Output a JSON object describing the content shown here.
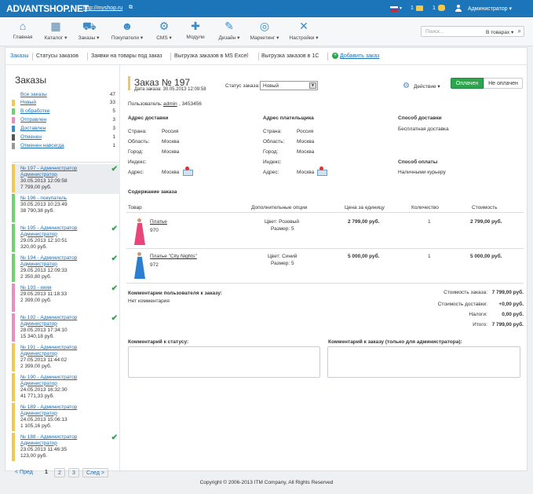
{
  "topbar": {
    "logo": "ADVANTSHOP.NET",
    "site_link": "http://myshop.ru",
    "ext_icon": "external-link-icon",
    "mail_count": "1",
    "messages_count": "1",
    "admin_name": "Администратор ▾",
    "bar_color": "#1c74b9"
  },
  "menu": [
    {
      "label": "Главная",
      "icon": "home-icon",
      "glyph": "⌂"
    },
    {
      "label": "Каталог ▾",
      "icon": "catalog-icon",
      "glyph": "▦"
    },
    {
      "label": "Заказы ▾",
      "icon": "cart-icon",
      "glyph": "⛟"
    },
    {
      "label": "Покупатели ▾",
      "icon": "users-icon",
      "glyph": "☻"
    },
    {
      "label": "CMS ▾",
      "icon": "gear-icon",
      "glyph": "⚙"
    },
    {
      "label": "Модули",
      "icon": "modules-icon",
      "glyph": "✚"
    },
    {
      "label": "Дизайн ▾",
      "icon": "palette-icon",
      "glyph": "✎"
    },
    {
      "label": "Маркетинг ▾",
      "icon": "target-icon",
      "glyph": "◎"
    },
    {
      "label": "Настройки ▾",
      "icon": "wrench-icon",
      "glyph": "✕"
    }
  ],
  "search": {
    "placeholder": "Поиск...",
    "scope": "В товарах ▾"
  },
  "tabs": [
    "Заказы",
    "Статусы заказов",
    "Заявки на товары под заказ",
    "Выгрузка заказов в MS Excel",
    "Выгрузка заказов в 1С",
    "Добавить заказ"
  ],
  "sidebar": {
    "title": "Заказы",
    "statuses": [
      {
        "name": "Все заказы",
        "count": "47",
        "color": "#ffffff"
      },
      {
        "name": "Новый",
        "count": "33",
        "color": "#f2c94c"
      },
      {
        "name": "В обработке",
        "count": "5",
        "color": "#6fd26f"
      },
      {
        "name": "Отправлен",
        "count": "3",
        "color": "#e88fc0"
      },
      {
        "name": "Доставлен",
        "count": "3",
        "color": "#3a8cc9"
      },
      {
        "name": "Отменен",
        "count": "1",
        "color": "#555555"
      },
      {
        "name": "Отменен навсегда",
        "count": "1",
        "color": "#999999"
      }
    ],
    "orders": [
      {
        "title": "№ 197 - Администратор Администратор",
        "date": "30.05.2013 12:09:58",
        "sum": "7 799,00 руб.",
        "color": "#f2c94c",
        "paid": true,
        "selected": true
      },
      {
        "title": "№ 196 - покупатель",
        "date": "30.05.2013 10:23:49",
        "sum": "38 790,38 руб.",
        "color": "#6fd26f",
        "paid": false
      },
      {
        "title": "№ 195 - Администратор Администратор",
        "date": "29.05.2013 12:10:51",
        "sum": "320,00 руб.",
        "color": "#6fd26f",
        "paid": true
      },
      {
        "title": "№ 194 - Администратор Администратор",
        "date": "29.05.2013 12:09:33",
        "sum": "2 350,80 руб.",
        "color": "#6fd26f",
        "paid": true
      },
      {
        "title": "№ 193 - яяяя",
        "date": "29.05.2013 11:18:33",
        "sum": "2 399,00 руб.",
        "color": "#e88fc0",
        "paid": true
      },
      {
        "title": "№ 192 - Администратор Администратор",
        "date": "28.05.2013 17:34:10",
        "sum": "15 340,18 руб.",
        "color": "#e88fc0",
        "paid": true
      },
      {
        "title": "№ 191 - Администратор Администратор",
        "date": "27.05.2013 11:44:02",
        "sum": "2 399,00 руб.",
        "color": "#f2c94c",
        "paid": false
      },
      {
        "title": "№ 190 - Администратор Администратор",
        "date": "24.05.2013 16:32:30",
        "sum": "41 771,33 руб.",
        "color": "#f2c94c",
        "paid": false
      },
      {
        "title": "№ 189 - Администратор Администратор",
        "date": "24.05.2013 15:06:13",
        "sum": "1 105,16 руб.",
        "color": "#f2c94c",
        "paid": false
      },
      {
        "title": "№ 188 - Администратор Администратор",
        "date": "23.05.2013 11:46:35",
        "sum": "123,00 руб.",
        "color": "#f2c94c",
        "paid": true
      }
    ],
    "pager": {
      "prev": "< Пред",
      "pages": [
        "1",
        "2",
        "3"
      ],
      "next": "След >"
    }
  },
  "order": {
    "title": "Заказ № 197",
    "date": "Дата заказа: 30.05.2013 12:09:58",
    "status_label": "Статус заказа:",
    "status_value": "Новый",
    "action": "Действие ▾",
    "paid": "Оплачен",
    "unpaid": "Не оплачен",
    "user_label": "Пользователь:",
    "user_link": "admin",
    "user_phone": ", 3453456",
    "delivery_addr": {
      "title": "Адрес доставки",
      "rows": [
        [
          "Страна:",
          "Россия"
        ],
        [
          "Область:",
          "Москва"
        ],
        [
          "Город:",
          "Москва"
        ],
        [
          "Индекс:",
          ""
        ],
        [
          "Адрес:",
          "Москва"
        ]
      ]
    },
    "payer_addr": {
      "title": "Адрес плательщика",
      "rows": [
        [
          "Страна:",
          "Россия"
        ],
        [
          "Область:",
          "Москва"
        ],
        [
          "Город:",
          "Москва"
        ],
        [
          "Индекс:",
          ""
        ],
        [
          "Адрес:",
          "Москва"
        ]
      ]
    },
    "shipping": {
      "title": "Способ доставки",
      "value": "Бесплатная доставка"
    },
    "payment": {
      "title": "Способ оплаты",
      "value": "Наличными курьеру"
    },
    "content_title": "Содержание заказа",
    "columns": [
      "Товар",
      "Дополнительные опции",
      "Цена за единицу",
      "Количество",
      "Стоимость"
    ],
    "items": [
      {
        "name": "Платье",
        "sku": "970",
        "opt1": "Цвет: Розовый",
        "opt2": "Размер: 5",
        "price": "2 799,00 руб.",
        "qty": "1",
        "total": "2 799,00 руб.",
        "color": "#e8457a"
      },
      {
        "name": "Платье \"City Nights\"",
        "sku": "972",
        "opt1": "Цвет: Синий",
        "opt2": "Размер: 5",
        "price": "5 000,00 руб.",
        "qty": "1",
        "total": "5 000,00 руб.",
        "color": "#2a7fd0"
      }
    ],
    "user_comment_title": "Комментарии пользователя к заказу:",
    "user_comment": "Нет комментария",
    "totals": [
      [
        "Стоимость заказа:",
        "7 799,00 руб."
      ],
      [
        "Стоимость доставки:",
        "+0,00 руб."
      ],
      [
        "Налоги:",
        "0,00 руб."
      ],
      [
        "Итого:",
        "7 799,00 руб."
      ]
    ],
    "status_comment_title": "Комментарий к статусу:",
    "admin_comment_title": "Комментарий к заказу (только для администратора):"
  },
  "footer": "Copyright © 2006-2013 ITM Company, All Rights Reserved"
}
